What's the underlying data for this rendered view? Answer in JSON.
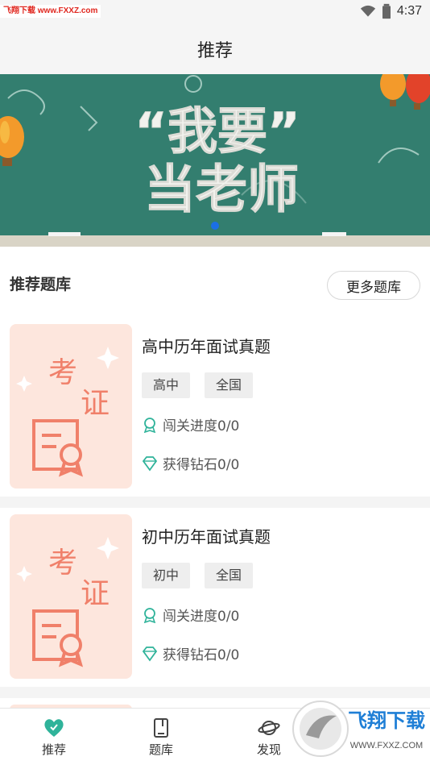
{
  "status_bar": {
    "watermark": "飞翔下载 www.FXXZ.com",
    "time": "4:37",
    "icons": [
      "wifi-icon",
      "battery-icon"
    ]
  },
  "header": {
    "title": "推荐"
  },
  "banner": {
    "text_line1": "“我要”",
    "text_line2": "当老师",
    "active_page": 1,
    "page_count": 1
  },
  "section": {
    "title": "推荐题库",
    "more_label": "更多题库"
  },
  "cards": [
    {
      "thumb_text": [
        "考",
        "证"
      ],
      "title": "高中历年面试真题",
      "tags": [
        "高中",
        "全国"
      ],
      "progress": "闯关进度0/0",
      "diamonds": "获得钻石0/0"
    },
    {
      "thumb_text": [
        "考",
        "证"
      ],
      "title": "初中历年面试真题",
      "tags": [
        "初中",
        "全国"
      ],
      "progress": "闯关进度0/0",
      "diamonds": "获得钻石0/0"
    }
  ],
  "bottom_nav": {
    "items": [
      {
        "label": "推荐",
        "icon": "heart-icon",
        "active": true
      },
      {
        "label": "题库",
        "icon": "book-icon",
        "active": false
      },
      {
        "label": "发现",
        "icon": "planet-icon",
        "active": false
      }
    ]
  },
  "watermark_logo": {
    "text": "飞翔下载",
    "url": "WWW.FXXZ.COM"
  },
  "colors": {
    "accent": "#2fb39a",
    "thumb_bg": "#fde6dd",
    "thumb_text": "#f0806a",
    "banner_bg": "#2f7a6b"
  }
}
